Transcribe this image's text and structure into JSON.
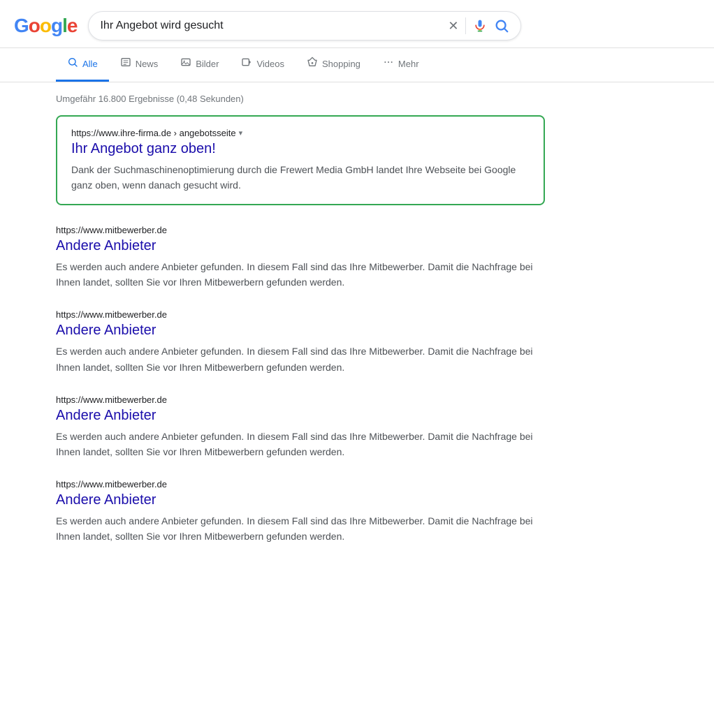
{
  "header": {
    "logo": "Google",
    "search_query": "Ihr Angebot wird gesucht",
    "clear_label": "×",
    "mic_label": "voice search",
    "search_icon_label": "search"
  },
  "nav": {
    "tabs": [
      {
        "id": "alle",
        "label": "Alle",
        "active": true,
        "icon": "search"
      },
      {
        "id": "news",
        "label": "News",
        "active": false,
        "icon": "news"
      },
      {
        "id": "bilder",
        "label": "Bilder",
        "active": false,
        "icon": "image"
      },
      {
        "id": "videos",
        "label": "Videos",
        "active": false,
        "icon": "video"
      },
      {
        "id": "shopping",
        "label": "Shopping",
        "active": false,
        "icon": "tag"
      },
      {
        "id": "mehr",
        "label": "Mehr",
        "active": false,
        "icon": "dots"
      }
    ]
  },
  "results": {
    "stats": "Umgefähr 16.800 Ergebnisse (0,48 Sekunden)",
    "items": [
      {
        "id": "featured",
        "highlighted": true,
        "url": "https://www.ihre-firma.de",
        "breadcrumb": "angebotsseite",
        "title": "Ihr Angebot ganz oben!",
        "snippet": "Dank der Suchmaschinenoptimierung durch die Frewert Media GmbH landet Ihre Webseite bei Google ganz oben, wenn danach gesucht wird."
      },
      {
        "id": "competitor1",
        "highlighted": false,
        "url": "https://www.mitbewerber.de",
        "breadcrumb": "",
        "title": "Andere Anbieter",
        "snippet": "Es werden auch andere Anbieter gefunden. In diesem Fall sind das Ihre Mitbewerber. Damit die Nachfrage bei Ihnen landet, sollten Sie vor Ihren Mitbewerbern gefunden werden."
      },
      {
        "id": "competitor2",
        "highlighted": false,
        "url": "https://www.mitbewerber.de",
        "breadcrumb": "",
        "title": "Andere Anbieter",
        "snippet": "Es werden auch andere Anbieter gefunden. In diesem Fall sind das Ihre Mitbewerber. Damit die Nachfrage bei Ihnen landet, sollten Sie vor Ihren Mitbewerbern gefunden werden."
      },
      {
        "id": "competitor3",
        "highlighted": false,
        "url": "https://www.mitbewerber.de",
        "breadcrumb": "",
        "title": "Andere Anbieter",
        "snippet": "Es werden auch andere Anbieter gefunden. In diesem Fall sind das Ihre Mitbewerber. Damit die Nachfrage bei Ihnen landet, sollten Sie vor Ihren Mitbewerbern gefunden werden."
      },
      {
        "id": "competitor4",
        "highlighted": false,
        "url": "https://www.mitbewerber.de",
        "breadcrumb": "",
        "title": "Andere Anbieter",
        "snippet": "Es werden auch andere Anbieter gefunden. In diesem Fall sind das Ihre Mitbewerber. Damit die Nachfrage bei Ihnen landet, sollten Sie vor Ihren Mitbewerbern gefunden werden."
      }
    ]
  },
  "colors": {
    "google_blue": "#4285F4",
    "google_red": "#EA4335",
    "google_yellow": "#FBBC05",
    "google_green": "#34A853",
    "link_color": "#1a0dab",
    "highlight_border": "#34A853"
  }
}
